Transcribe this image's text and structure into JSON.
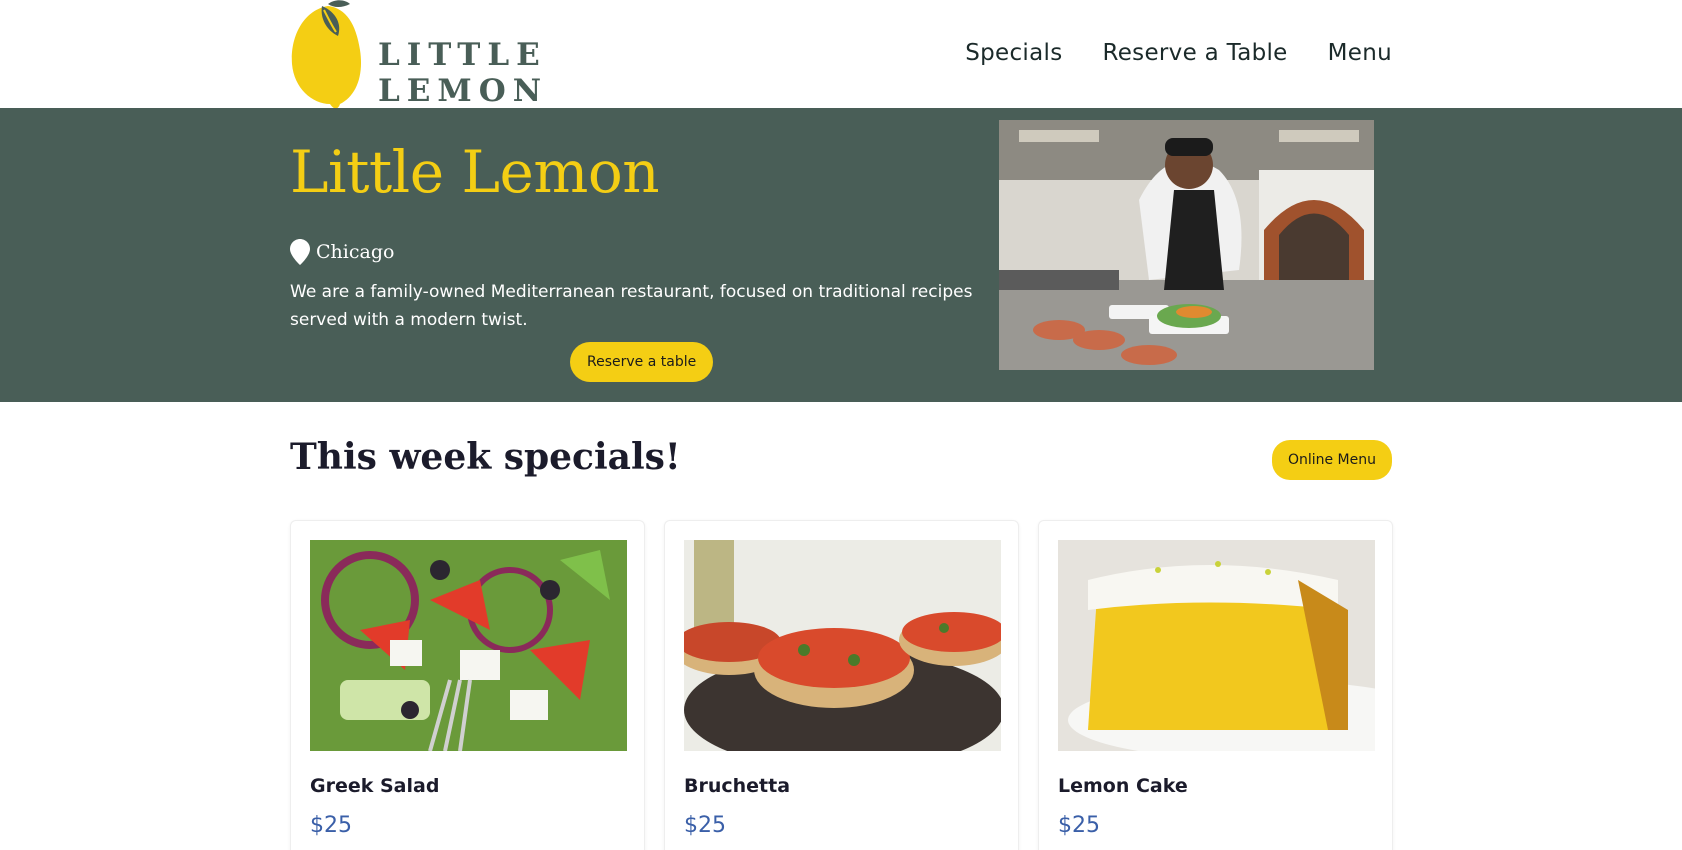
{
  "brand": {
    "name": "LITTLE LEMON"
  },
  "nav": [
    {
      "label": "Specials"
    },
    {
      "label": "Reserve a Table"
    },
    {
      "label": "Menu"
    }
  ],
  "hero": {
    "title": "Little Lemon",
    "city": "Chicago",
    "description": "We are a family-owned Mediterranean restaurant, focused on traditional recipes served with a modern twist.",
    "button": "Reserve a table"
  },
  "specials": {
    "title": "This week specials!",
    "button": "Online Menu",
    "items": [
      {
        "name": "Greek Salad",
        "price": "$25"
      },
      {
        "name": "Bruchetta",
        "price": "$25"
      },
      {
        "name": "Lemon Cake",
        "price": "$25"
      }
    ]
  },
  "colors": {
    "primary_green": "#495e57",
    "primary_yellow": "#f4ce14",
    "price_blue": "#3a5fa8"
  }
}
